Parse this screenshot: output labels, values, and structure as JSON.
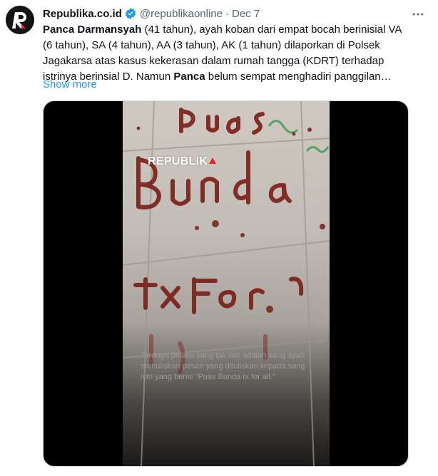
{
  "account": {
    "display_name": "Republika.co.id",
    "handle": "@republikaonline",
    "separator": "·",
    "date": "Dec 7",
    "avatar_icon": "republika-logo-icon",
    "verified_icon": "verified-badge-icon"
  },
  "tweet": {
    "name_bold": "Panca Darmansyah",
    "text_1": " (41 tahun), ayah koban dari empat bocah berinisial VA (6 tahun), SA (4 tahun), AA (3 tahun), AK (1 tahun) dilaporkan di Polsek Jagakarsa atas kasus kekerasan dalam rumah tangga (KDRT) terhadap istrinya berinsial D. Namun ",
    "name_bold_2": "Panca",
    "text_2": " belum sempat menghadiri panggilan…",
    "show_more": "Show more"
  },
  "media": {
    "watermark": "REPUBLIK",
    "caption": "Terduga pelaku yang tak lain adalah sang ayah menuliskan pesan yang dituliskan kepada sang istri yang berisi \"Puas Bunda tx for all.\""
  },
  "colors": {
    "link": "#1d9bf0",
    "verified": "#1d9bf0",
    "muted": "#536471",
    "blood": "#7a1d17"
  }
}
